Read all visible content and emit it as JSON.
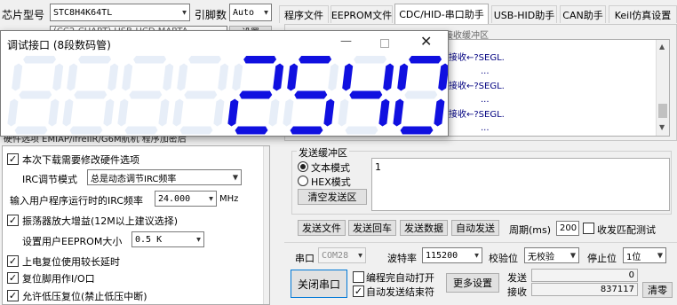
{
  "left": {
    "chip_label": "芯片型号",
    "chip_value": "STC8H4K64TL",
    "pin_label": "引脚数",
    "pin_value": "Auto",
    "row2_partial": "(CC2-CUART) USB-UCD MARTA",
    "row2_button": "设置",
    "row3_partial": "硬件选项  EMIAP/ifreIIR/G6M航机  程序加密后",
    "options": [
      {
        "checked": true,
        "label": "本次下载需要修改硬件选项"
      },
      {
        "label": "IRC调节模式",
        "select": "总是动态调节IRC频率"
      },
      {
        "label": "输入用户程序运行时的IRC频率",
        "value": "24.000",
        "unit": "MHz"
      },
      {
        "checked": true,
        "label": "振荡器放大增益(12M以上建议选择)"
      },
      {
        "label": "设置用户EEPROM大小",
        "select": "0.5 K"
      },
      {
        "checked": true,
        "label": "上电复位使用较长延时"
      },
      {
        "checked": true,
        "label": "复位脚用作I/O口"
      },
      {
        "checked": true,
        "label": "允许低压复位(禁止低压中断)"
      }
    ]
  },
  "tabs": [
    "程序文件",
    "EEPROM文件",
    "CDC/HID-串口助手",
    "USB-HID助手",
    "CAN助手",
    "Keil仿真设置"
  ],
  "active_tab": 2,
  "receive": {
    "header_partial": "接收缓冲区",
    "lines": [
      "接收←?SEGL.",
      "...",
      "接收←?SEGL.",
      "...",
      "接收←?SEGL.",
      "..."
    ]
  },
  "send": {
    "group_label": "发送缓冲区",
    "mode_text": "文本模式",
    "mode_hex": "HEX模式",
    "clear_button": "清空发送区",
    "content": "1"
  },
  "send_buttons": [
    "发送文件",
    "发送回车",
    "发送数据",
    "自动发送"
  ],
  "period": {
    "label": "周期(ms)",
    "value": "200",
    "match_label": "收发匹配测试"
  },
  "serial": {
    "port_label": "串口",
    "port_value": "COM28",
    "baud_label": "波特率",
    "baud_value": "115200",
    "parity_label": "校验位",
    "parity_value": "无校验",
    "stop_label": "停止位",
    "stop_value": "1位",
    "close_button": "关闭串口",
    "auto_open": "编程完自动打开",
    "auto_send_end": "自动发送结束符",
    "more_button": "更多设置",
    "send_label": "发送",
    "send_count": "0",
    "recv_label": "接收",
    "recv_count": "837117",
    "clear_button": "清零"
  },
  "dialog": {
    "title": "调试接口 (8段数码管)",
    "display_value": "2540",
    "minimize_icon": "minimize-icon",
    "maximize_icon": "maximize-icon",
    "close_icon": "close-icon"
  },
  "colors": {
    "segment_on": "#1010e0",
    "segment_ghost": "#e7eef8",
    "receive_text": "#000080"
  }
}
